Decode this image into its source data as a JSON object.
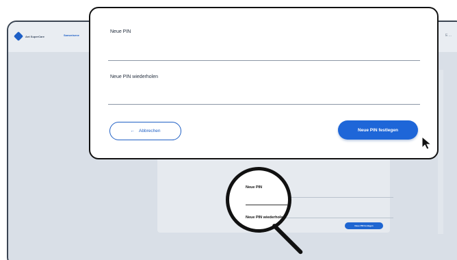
{
  "background": {
    "brand_name": "Ant SuperCare",
    "nav_tab": "Sanweisene",
    "topbar_right": "E ...",
    "field1_label": "Neue PIN",
    "field2_label": "Neue PIN wiederholen",
    "submit_label": "Neue PIN festlegen"
  },
  "magnifier": {
    "field1_label": "Neue PIN",
    "field2_label": "Neue PIN wiederholen"
  },
  "dialog": {
    "field1_label": "Neue PIN",
    "field1_value": "",
    "field2_label": "Neue PIN wiederholen",
    "field2_value": "",
    "cancel_label": "Abbrechen",
    "cancel_icon": "arrow-left-icon",
    "submit_label": "Neue PIN festlegen"
  },
  "colors": {
    "accent": "#1e66d8",
    "border": "#111111",
    "background_app": "#d9dfe7"
  }
}
